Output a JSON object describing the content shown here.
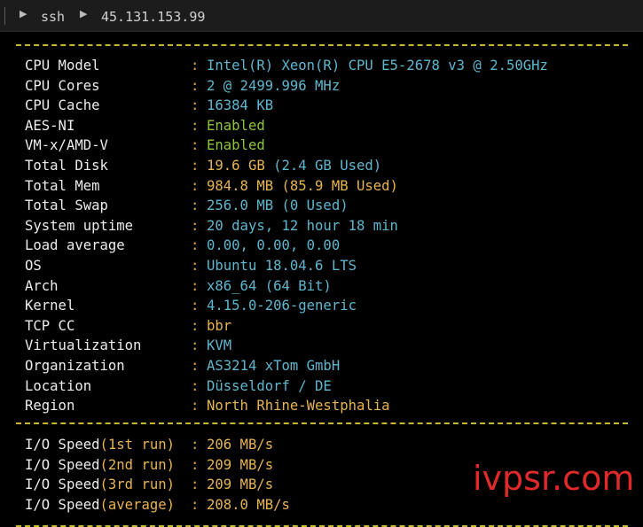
{
  "breadcrumb": {
    "item1": "ssh",
    "item2": "45.131.153.99"
  },
  "sysinfo": [
    {
      "label": "CPU Model",
      "value": "Intel(R) Xeon(R) CPU E5-2678 v3 @ 2.50GHz",
      "color": "#5fb6cf"
    },
    {
      "label": "CPU Cores",
      "value": "2 @ 2499.996 MHz",
      "color": "#5fb6cf"
    },
    {
      "label": "CPU Cache",
      "value": "16384 KB",
      "color": "#5fb6cf"
    },
    {
      "label": "AES-NI",
      "value": "Enabled",
      "color": "#8fc53c"
    },
    {
      "label": "VM-x/AMD-V",
      "value": "Enabled",
      "color": "#8fc53c"
    },
    {
      "label": "Total Disk",
      "value_main": "19.6 GB",
      "value_extra": " (2.4 GB Used)",
      "color": "#e6b450",
      "extra_color": "#5fb6cf"
    },
    {
      "label": "Total Mem",
      "value": "984.8 MB (85.9 MB Used)",
      "color": "#e6b450"
    },
    {
      "label": "Total Swap",
      "value": "256.0 MB (0 Used)",
      "color": "#5fb6cf"
    },
    {
      "label": "System uptime",
      "value": "20 days, 12 hour 18 min",
      "color": "#5fb6cf"
    },
    {
      "label": "Load average",
      "value": "0.00, 0.00, 0.00",
      "color": "#5fb6cf"
    },
    {
      "label": "OS",
      "value": "Ubuntu 18.04.6 LTS",
      "color": "#5fb6cf"
    },
    {
      "label": "Arch",
      "value": "x86_64 (64 Bit)",
      "color": "#5fb6cf"
    },
    {
      "label": "Kernel",
      "value": "4.15.0-206-generic",
      "color": "#5fb6cf"
    },
    {
      "label": "TCP CC",
      "value": "bbr",
      "color": "#e6b450"
    },
    {
      "label": "Virtualization",
      "value": "KVM",
      "color": "#5fb6cf"
    },
    {
      "label": "Organization",
      "value": "AS3214 xTom GmbH",
      "color": "#5fb6cf"
    },
    {
      "label": "Location",
      "value": "Düsseldorf / DE",
      "color": "#5fb6cf"
    },
    {
      "label": "Region",
      "value": "North Rhine-Westphalia",
      "color": "#e6b450"
    }
  ],
  "separator": ":",
  "io": [
    {
      "prefix": "I/O Speed",
      "paren": "(1st run)",
      "value": "206 MB/s"
    },
    {
      "prefix": "I/O Speed",
      "paren": "(2nd run)",
      "value": "209 MB/s"
    },
    {
      "prefix": "I/O Speed",
      "paren": "(3rd run)",
      "value": "209 MB/s"
    },
    {
      "prefix": "I/O Speed",
      "paren": "(average)",
      "value": "208.0 MB/s"
    }
  ],
  "io_label_color": "#ececec",
  "io_paren_color": "#e6b450",
  "io_value_color": "#e6b450",
  "watermark": "ivpsr.com"
}
